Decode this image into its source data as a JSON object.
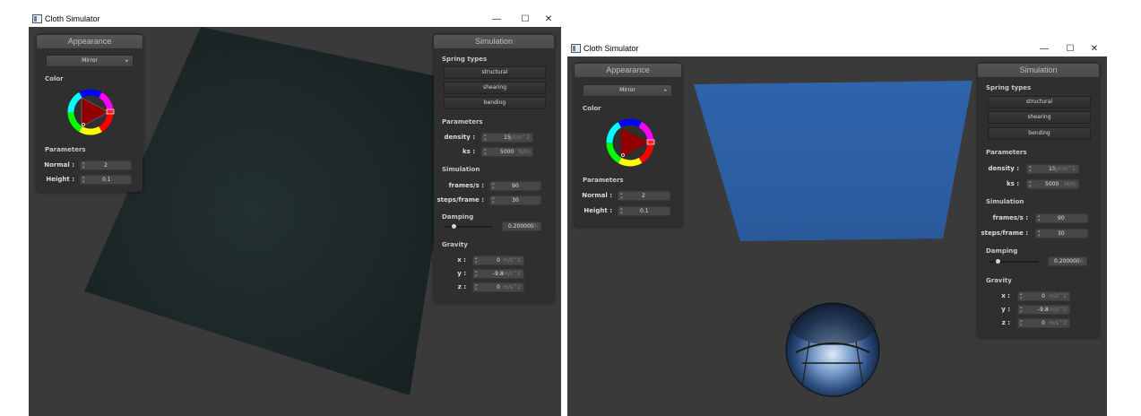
{
  "windows": [
    {
      "title": "Cloth Simulator",
      "controls": {
        "minimize": "—",
        "maximize": "☐",
        "close": "✕"
      },
      "appearance": {
        "header": "Appearance",
        "shader_value": "Mirror",
        "color_label": "Color",
        "parameters_label": "Parameters",
        "normal_label": "Normal :",
        "normal_value": "2",
        "height_label": "Height :",
        "height_value": "0.1"
      },
      "simulation": {
        "header": "Simulation",
        "spring_types_label": "Spring types",
        "structural": "structural",
        "shearing": "shearing",
        "bending": "bending",
        "parameters_label": "Parameters",
        "density_label": "density :",
        "density_value": "15",
        "density_unit": "g/cm^2",
        "ks_label": "ks :",
        "ks_value": "5000",
        "ks_unit": "N/m",
        "simulation_label": "Simulation",
        "fps_label": "frames/s :",
        "fps_value": "90",
        "steps_label": "steps/frame :",
        "steps_value": "30",
        "damping_label": "Damping",
        "damping_value": "0.200000",
        "damping_unit": "%",
        "damping_fraction": 0.2,
        "gravity_label": "Gravity",
        "gx_label": "x :",
        "gx_value": "0",
        "gx_unit": "m/s^2",
        "gy_label": "y :",
        "gy_value": "-9.8",
        "gy_unit": "m/s^2",
        "gz_label": "z :",
        "gz_value": "0",
        "gz_unit": "m/s^2"
      },
      "cloth_color": "#1d2624"
    },
    {
      "title": "Cloth Simulator",
      "controls": {
        "minimize": "—",
        "maximize": "☐",
        "close": "✕"
      },
      "appearance": {
        "header": "Appearance",
        "shader_value": "Mirror",
        "color_label": "Color",
        "parameters_label": "Parameters",
        "normal_label": "Normal :",
        "normal_value": "2",
        "height_label": "Height :",
        "height_value": "0.1"
      },
      "simulation": {
        "header": "Simulation",
        "spring_types_label": "Spring types",
        "structural": "structural",
        "shearing": "shearing",
        "bending": "bending",
        "parameters_label": "Parameters",
        "density_label": "density :",
        "density_value": "15",
        "density_unit": "g/cm^2",
        "ks_label": "ks :",
        "ks_value": "5000",
        "ks_unit": "N/m",
        "simulation_label": "Simulation",
        "fps_label": "frames/s :",
        "fps_value": "90",
        "steps_label": "steps/frame :",
        "steps_value": "30",
        "damping_label": "Damping",
        "damping_value": "0.200000",
        "damping_unit": "%",
        "damping_fraction": 0.2,
        "gravity_label": "Gravity",
        "gx_label": "x :",
        "gx_value": "0",
        "gx_unit": "m/s^2",
        "gy_label": "y :",
        "gy_value": "-9.8",
        "gy_unit": "m/s^2",
        "gz_label": "z :",
        "gz_value": "0",
        "gz_unit": "m/s^2"
      },
      "cloth_color": "#2d5fa3"
    }
  ]
}
